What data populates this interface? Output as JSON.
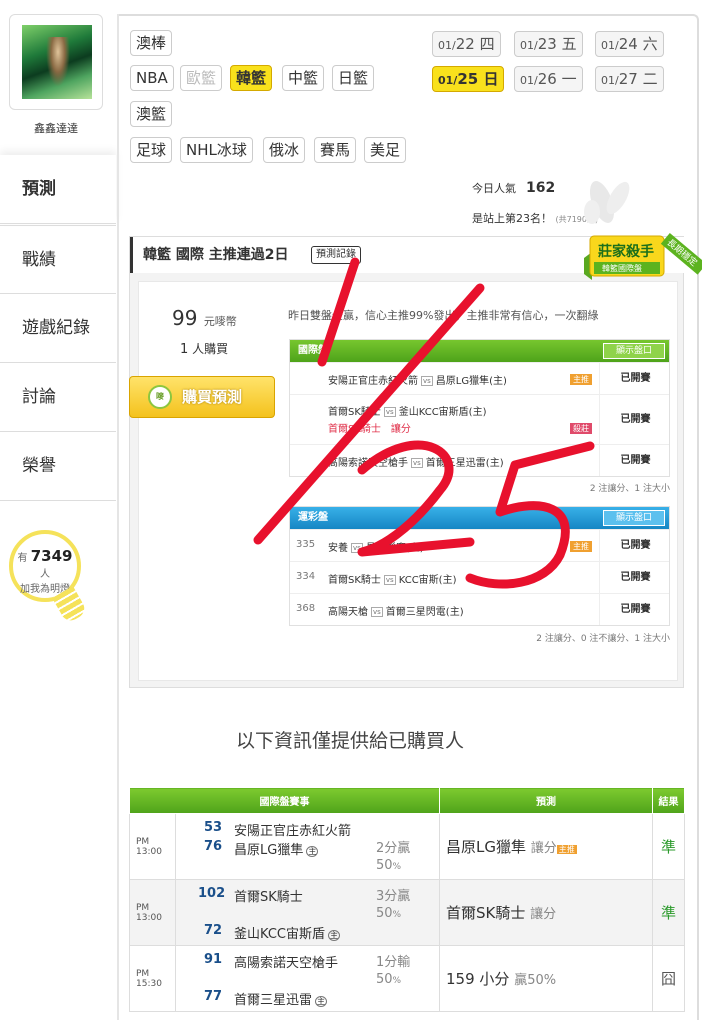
{
  "user": {
    "name": "鑫鑫達達",
    "fans_prefix": "有",
    "fans_count": "7349",
    "fans_suffix": "人",
    "fans_cta": "加我為明燈"
  },
  "nav": [
    {
      "label": "預測"
    },
    {
      "label": "戰績"
    },
    {
      "label": "遊戲紀錄"
    },
    {
      "label": "討論"
    },
    {
      "label": "榮譽"
    }
  ],
  "sports": [
    "澳棒",
    "NBA",
    "歐籃",
    "韓籃",
    "中籃",
    "日籃",
    "澳籃",
    "足球",
    "NHL冰球",
    "俄冰",
    "賽馬",
    "美足"
  ],
  "dates": [
    {
      "md": "01/",
      "day": "22",
      "wd": "四"
    },
    {
      "md": "01/",
      "day": "23",
      "wd": "五"
    },
    {
      "md": "01/",
      "day": "24",
      "wd": "六"
    },
    {
      "md": "01/",
      "day": "25",
      "wd": "日"
    },
    {
      "md": "01/",
      "day": "26",
      "wd": "一"
    },
    {
      "md": "01/",
      "day": "27",
      "wd": "二"
    }
  ],
  "popularity": {
    "label": "今日人氣",
    "value": "162",
    "rank_text": "是站上第23名！",
    "rank_note": "(共7190人)"
  },
  "panel": {
    "title": "韓籃 國際 主推連過2日",
    "record_btn": "預測記錄",
    "badge_main": "莊家殺手",
    "badge_sub": "韓籃國際盤",
    "badge_ribbon": "長期穩定",
    "price": "99",
    "price_unit": "元嘜幣",
    "buyers_count": "1",
    "buyers_label": "人購買",
    "buy_btn": "購買預測",
    "buy_icon": "嘜",
    "note": "昨日雙盤全贏，信心主推99%發出，主推非常有信心，一次翻綠",
    "intl": {
      "header": "國際盤",
      "show_btn": "顯示盤口",
      "rows": [
        {
          "away": "安陽正官庄赤紅火箭",
          "vs": "vs",
          "home": "昌原LG獵隼(主)",
          "tag": "主推",
          "status": "已開賽"
        },
        {
          "away": "首爾SK騎士",
          "vs": "vs",
          "home": "釜山KCC宙斯盾(主)",
          "pick": "首爾SK騎士",
          "pick_type": "讓分",
          "tag": "殺莊",
          "status": "已開賽"
        },
        {
          "away": "高陽索諾天空槍手",
          "vs": "vs",
          "home": "首爾三星迅雷(主)",
          "status": "已開賽"
        }
      ],
      "summary": "2 注讓分、1 注大小"
    },
    "lottery": {
      "header": "運彩盤",
      "show_btn": "顯示盤口",
      "rows": [
        {
          "num": "335",
          "away": "安養",
          "vs": "vs",
          "home": "昌原獵鷹(主)",
          "tag": "主推",
          "status": "已開賽"
        },
        {
          "num": "334",
          "away": "首爾SK騎士",
          "vs": "vs",
          "home": "KCC宙斯(主)",
          "status": "已開賽"
        },
        {
          "num": "368",
          "away": "高陽天槍",
          "vs": "vs",
          "home": "首爾三星閃電(主)",
          "status": "已開賽"
        }
      ],
      "summary": "2 注讓分、0 注不讓分、1 注大小"
    }
  },
  "info_heading": "以下資訊僅提供給已購買人",
  "results": {
    "headers": [
      "國際盤賽事",
      "預測",
      "結果"
    ],
    "rows": [
      {
        "time": "PM 13:00",
        "n1": "53",
        "t1": "安陽正官庄赤紅火箭",
        "n2": "76",
        "t2": "昌原LG獵隼",
        "home": "主",
        "spread": "2分贏",
        "pct": "50",
        "pct_unit": "%",
        "pick": "昌原LG獵隼",
        "pick_type": "讓分",
        "tag": "主推",
        "result": "準"
      },
      {
        "time": "PM 13:00",
        "n1": "102",
        "t1": "首爾SK騎士",
        "n2": "72",
        "t2": "釜山KCC宙斯盾",
        "home": "主",
        "spread": "3分贏",
        "pct": "50",
        "pct_unit": "%",
        "pick": "首爾SK騎士",
        "pick_type": "讓分",
        "result": "準"
      },
      {
        "time": "PM 15:30",
        "n1": "91",
        "t1": "高陽索諾天空槍手",
        "n2": "77",
        "t2": "首爾三星迅雷",
        "home": "主",
        "spread": "1分輸",
        "pct": "50",
        "pct_unit": "%",
        "pick": "159 小分",
        "pick_type": "贏50%",
        "result": "囧"
      }
    ]
  },
  "colors": {
    "accent_yellow": "#f9e11c",
    "green": "#5cb31f",
    "blue": "#1a9ad6",
    "ink": "#e8112d"
  }
}
